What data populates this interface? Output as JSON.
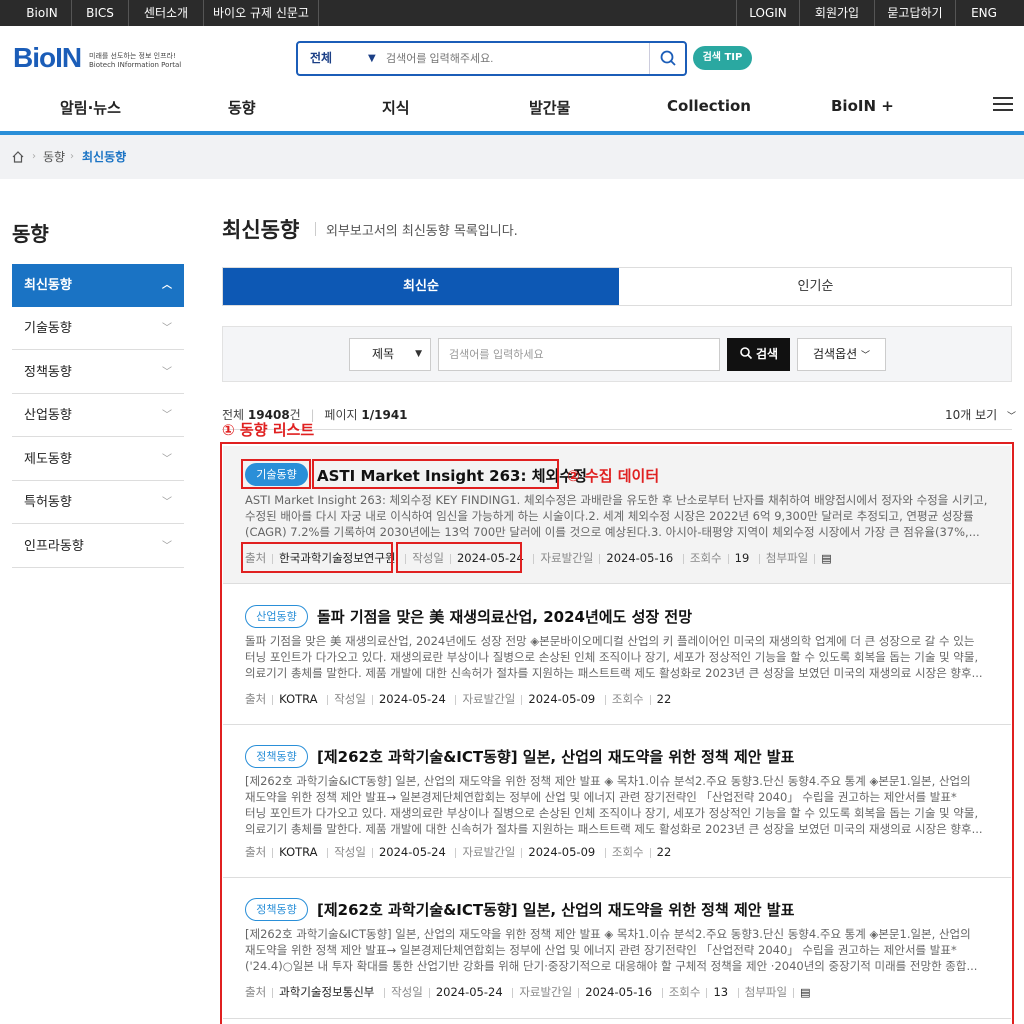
{
  "topbar": {
    "left": [
      "BioIN",
      "BICS",
      "센터소개",
      "바이오 규제 신문고"
    ],
    "right": [
      "LOGIN",
      "회원가입",
      "묻고답하기",
      "ENG"
    ]
  },
  "logo": {
    "main": "BioIN",
    "sub1": "미래를 선도하는 정보 인프라!",
    "sub2": "Biotech INformation Portal"
  },
  "search": {
    "category": "전체",
    "placeholder": "검색어를 입력해주세요.",
    "tip": "검색 TIP"
  },
  "gnb": [
    "알림·뉴스",
    "동향",
    "지식",
    "발간물",
    "Collection",
    "BioIN +"
  ],
  "breadcrumb": [
    "동향",
    "최신동향"
  ],
  "sidebar": {
    "title": "동향",
    "items": [
      "최신동향",
      "기술동향",
      "정책동향",
      "산업동향",
      "제도동향",
      "특허동향",
      "인프라동향"
    ]
  },
  "page": {
    "title": "최신동향",
    "desc": "외부보고서의 최신동향 목록입니다."
  },
  "tabs": [
    "최신순",
    "인기순"
  ],
  "filter": {
    "field": "제목",
    "placeholder": "검색어를 입력하세요",
    "search_btn": "검색",
    "options_btn": "검색옵션"
  },
  "summary": {
    "total_label": "전체",
    "total": "19408",
    "total_unit": "건",
    "page_label": "페이지",
    "page": "1",
    "pages": "/1941",
    "per_page": "10개 보기"
  },
  "annotations": {
    "list": "① 동향 리스트",
    "data": "② 수집 데이터"
  },
  "meta_labels": {
    "source": "출처",
    "written": "작성일",
    "published": "자료발간일",
    "views": "조회수",
    "attach": "첨부파일"
  },
  "items": [
    {
      "badge": "기술동향",
      "title": "ASTI Market Insight 263: 체외수정",
      "lines": [
        "ASTI Market Insight 263: 체외수정 KEY FINDING1. 체외수정은 과배란을 유도한 후 난소로부터 난자를 채취하여 배양접시에서 정자와 수정을 시키고,",
        "수정된 배아를 다시 자궁 내로 이식하여 임신을 가능하게 하는 시술이다.2. 세계 체외수정 시장은 2022년 6억 9,300만 달러로 추정되고, 연평균 성장률",
        "(CAGR) 7.2%를 기록하여 2030년에는 13억 700만 달러에 이를 것으로 예상된다.3. 아시아-태평양 지역이 체외수정 시장에서 가장 큰 점유율(37%,..."
      ],
      "source": "한국과학기술정보연구원",
      "written": "2024-05-24",
      "published": "2024-05-16",
      "views": "19"
    },
    {
      "badge": "산업동향",
      "title": "돌파 기점을 맞은 美 재생의료산업, 2024년에도 성장 전망",
      "lines": [
        "돌파 기점을 맞은 美 재생의료산업, 2024년에도 성장 전망 ◈본문바이오메디컬 산업의 키 플레이어인 미국의 재생의학 업계에 더 큰 성장으로 갈 수 있는",
        "터닝 포인트가 다가오고 있다. 재생의료란 부상이나 질병으로 손상된 인체 조직이나 장기, 세포가 정상적인 기능을 할 수 있도록 회복을 돕는 기술 및 약물,",
        "의료기기 총체를 말한다. 제품 개발에 대한 신속허가 절차를 지원하는 패스트트랙 제도 활성화로 2023년 큰 성장을 보였던 미국의 재생의료 시장은 향후..."
      ],
      "source": "KOTRA",
      "written": "2024-05-24",
      "published": "2024-05-09",
      "views": "22"
    },
    {
      "badge": "정책동향",
      "title": "[제262호 과학기술&ICT동향] 일본, 산업의 재도약을 위한 정책 제안 발표",
      "lines": [
        "[제262호 과학기술&ICT동향] 일본, 산업의 재도약을 위한 정책 제안 발표 ◈ 목차1.이슈 분석2.주요 동향3.단신 동향4.주요 통계 ◈본문1.일본, 산업의",
        "재도약을 위한 정책 제안 발표→ 일본경제단체연합회는 정부에 산업 및 에너지 관련 장기전략인 「산업전략 2040」 수립을 권고하는 제안서를 발표*",
        "터닝 포인트가 다가오고 있다. 재생의료란 부상이나 질병으로 손상된 인체 조직이나 장기, 세포가 정상적인 기능을 할 수 있도록 회복을 돕는 기술 및 약물,",
        "의료기기 총체를 말한다. 제품 개발에 대한 신속허가 절차를 지원하는 패스트트랙 제도 활성화로 2023년 큰 성장을 보였던 미국의 재생의료 시장은 향후..."
      ],
      "source": "KOTRA",
      "written": "2024-05-24",
      "published": "2024-05-09",
      "views": "22"
    },
    {
      "badge": "정책동향",
      "title": "[제262호 과학기술&ICT동향] 일본, 산업의 재도약을 위한 정책 제안 발표",
      "lines": [
        "[제262호 과학기술&ICT동향] 일본, 산업의 재도약을 위한 정책 제안 발표 ◈ 목차1.이슈 분석2.주요 동향3.단신 동향4.주요 통계 ◈본문1.일본, 산업의",
        "재도약을 위한 정책 제안 발표→ 일본경제단체연합회는 정부에 산업 및 에너지 관련 장기전략인 「산업전략 2040」 수립을 권고하는 제안서를 발표*",
        "('24.4)○일본 내 투자 확대를 통한 산업기반 강화를 위해 단기·중장기적으로 대응해야 할 구체적 정책을 제안 ·2040년의 중장기적 미래를 전망한 종합..."
      ],
      "source": "과학기술정보통신부",
      "written": "2024-05-24",
      "published": "2024-05-16",
      "views": "13"
    }
  ],
  "colors": {
    "brand": "#1b5db8",
    "accent": "#2a8fd8",
    "annotation": "#e02020",
    "tip": "#2aa8a1"
  }
}
